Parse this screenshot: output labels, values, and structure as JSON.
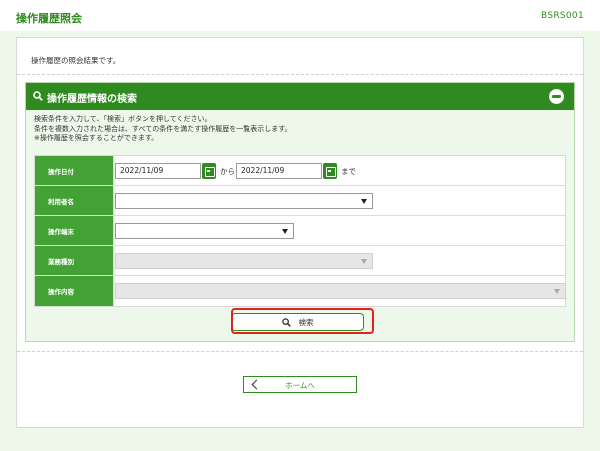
{
  "header": {
    "title": "操作履歴照会",
    "screen_id": "BSRS001"
  },
  "intro_text": "操作履歴の照会結果です。",
  "panel": {
    "title": "操作履歴情報の検索",
    "collapse_icon": "minus-circle-icon",
    "description": [
      "検索条件を入力して、「検索」ボタンを押してください。",
      "条件を複数入力された場合は、すべての条件を満たす操作履歴を一覧表示します。",
      "※操作履歴を照会することができます。"
    ]
  },
  "form": {
    "rows": [
      {
        "label": "操作日付"
      },
      {
        "label": "利用者名"
      },
      {
        "label": "操作端末"
      },
      {
        "label": "業務種別"
      },
      {
        "label": "操作内容"
      }
    ],
    "date_from": "2022/11/09",
    "date_from_connector": "から",
    "date_to": "2022/11/09",
    "date_to_connector": "まで",
    "user_select_value": "",
    "terminal_select_value": "",
    "business_type_value": "",
    "operation_value": ""
  },
  "buttons": {
    "search_label": "検索",
    "home_label": "ホームへ"
  },
  "colors": {
    "brand_green": "#2f8a1f",
    "label_green": "#43a234",
    "highlight_red": "#e2231a"
  }
}
